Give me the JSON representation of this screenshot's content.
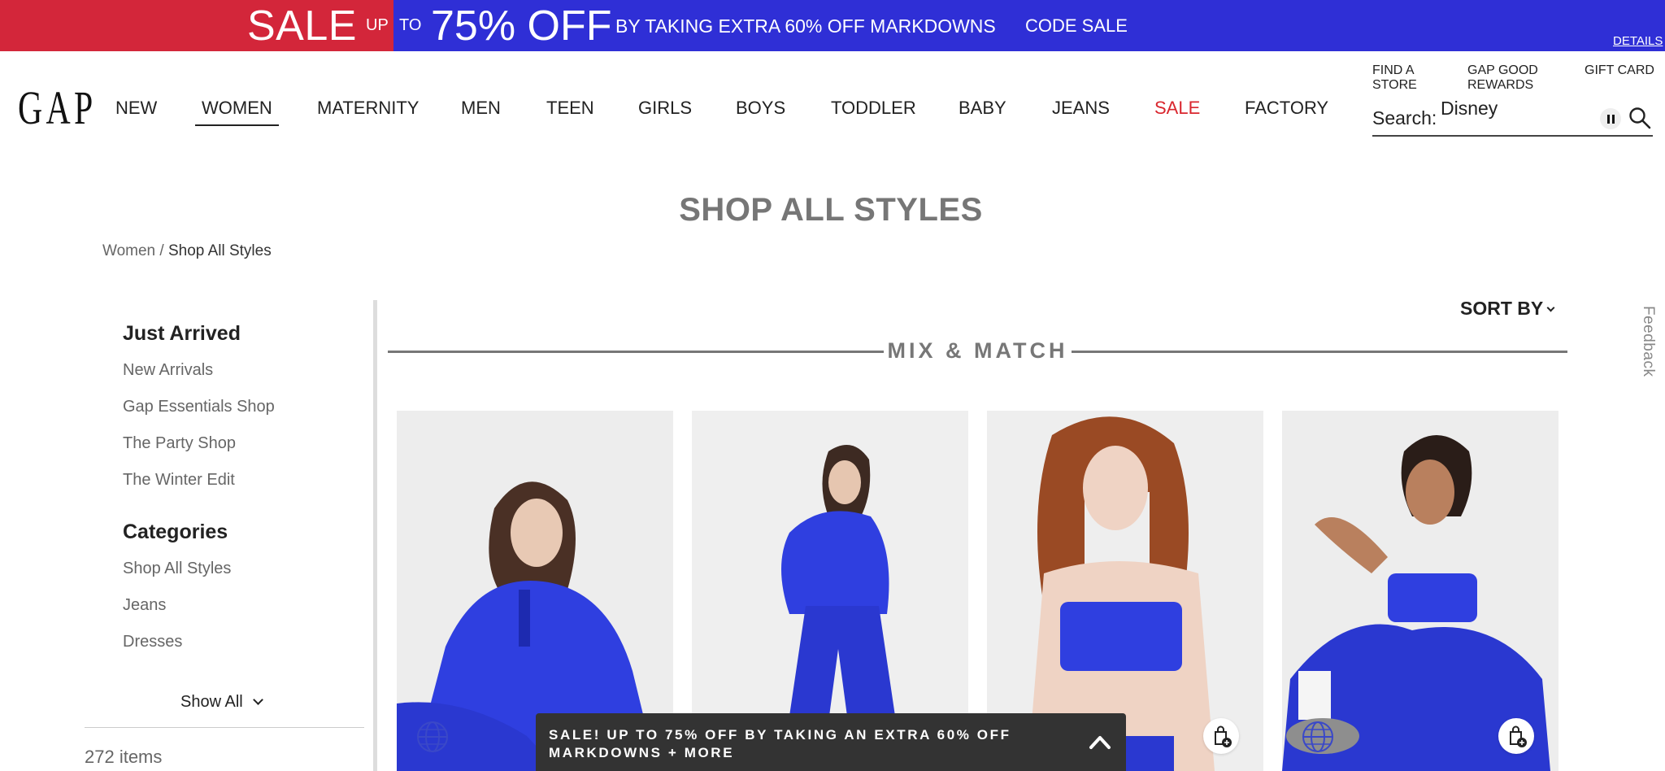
{
  "promo": {
    "sale": "SALE",
    "up": "UP",
    "to": "TO",
    "percent_off": "75% OFF",
    "markdowns": "BY TAKING EXTRA 60% OFF MARKDOWNS",
    "code": "CODE SALE",
    "details": "DETAILS",
    "colors": {
      "red": "#d3263a",
      "blue": "#2f2fd6"
    }
  },
  "header": {
    "logo": "GAP",
    "nav": [
      {
        "id": "new",
        "label": "NEW"
      },
      {
        "id": "women",
        "label": "WOMEN",
        "active": true
      },
      {
        "id": "maternity",
        "label": "MATERNITY"
      },
      {
        "id": "men",
        "label": "MEN"
      },
      {
        "id": "teen",
        "label": "TEEN"
      },
      {
        "id": "girls",
        "label": "GIRLS"
      },
      {
        "id": "boys",
        "label": "BOYS"
      },
      {
        "id": "toddler",
        "label": "TODDLER"
      },
      {
        "id": "baby",
        "label": "BABY"
      },
      {
        "id": "jeans",
        "label": "JEANS"
      },
      {
        "id": "sale",
        "label": "SALE"
      },
      {
        "id": "factory",
        "label": "FACTORY"
      }
    ],
    "utility": {
      "find_store_1": "FIND A",
      "find_store_2": "STORE",
      "rewards_1": "GAP GOOD",
      "rewards_2": "REWARDS",
      "gift_card": "GIFT CARD"
    },
    "search": {
      "label": "Search:",
      "value": "Disney"
    }
  },
  "page": {
    "title": "SHOP ALL STYLES",
    "breadcrumb": {
      "parent": "Women",
      "separator": " / ",
      "current": "Shop All Styles"
    },
    "sort_by": "SORT BY",
    "section_title": "MIX & MATCH",
    "feedback": "Feedback"
  },
  "sidebar": {
    "just_arrived": {
      "heading": "Just Arrived",
      "links": [
        "New Arrivals",
        "Gap Essentials Shop",
        "The Party Shop",
        "The Winter Edit"
      ]
    },
    "categories": {
      "heading": "Categories",
      "links": [
        "Shop All Styles",
        "Jeans",
        "Dresses"
      ]
    },
    "show_all": "Show All",
    "item_count": "272 items"
  },
  "products": [
    {
      "name": "product-1",
      "hair": "#4a3025",
      "pose": "seated-half-zip",
      "has_globe": true
    },
    {
      "name": "product-2",
      "hair": "#3d2a22",
      "pose": "standing-half-zip",
      "has_globe": false
    },
    {
      "name": "product-3",
      "hair": "#9a4a24",
      "pose": "bandeau-top",
      "has_globe": false
    },
    {
      "name": "product-4",
      "hair": "#2a1d18",
      "pose": "seated-leggings",
      "has_globe": true
    }
  ],
  "sale_bar": {
    "text": "SALE! UP TO 75% OFF BY TAKING AN EXTRA 60% OFF MARKDOWNS + MORE"
  }
}
